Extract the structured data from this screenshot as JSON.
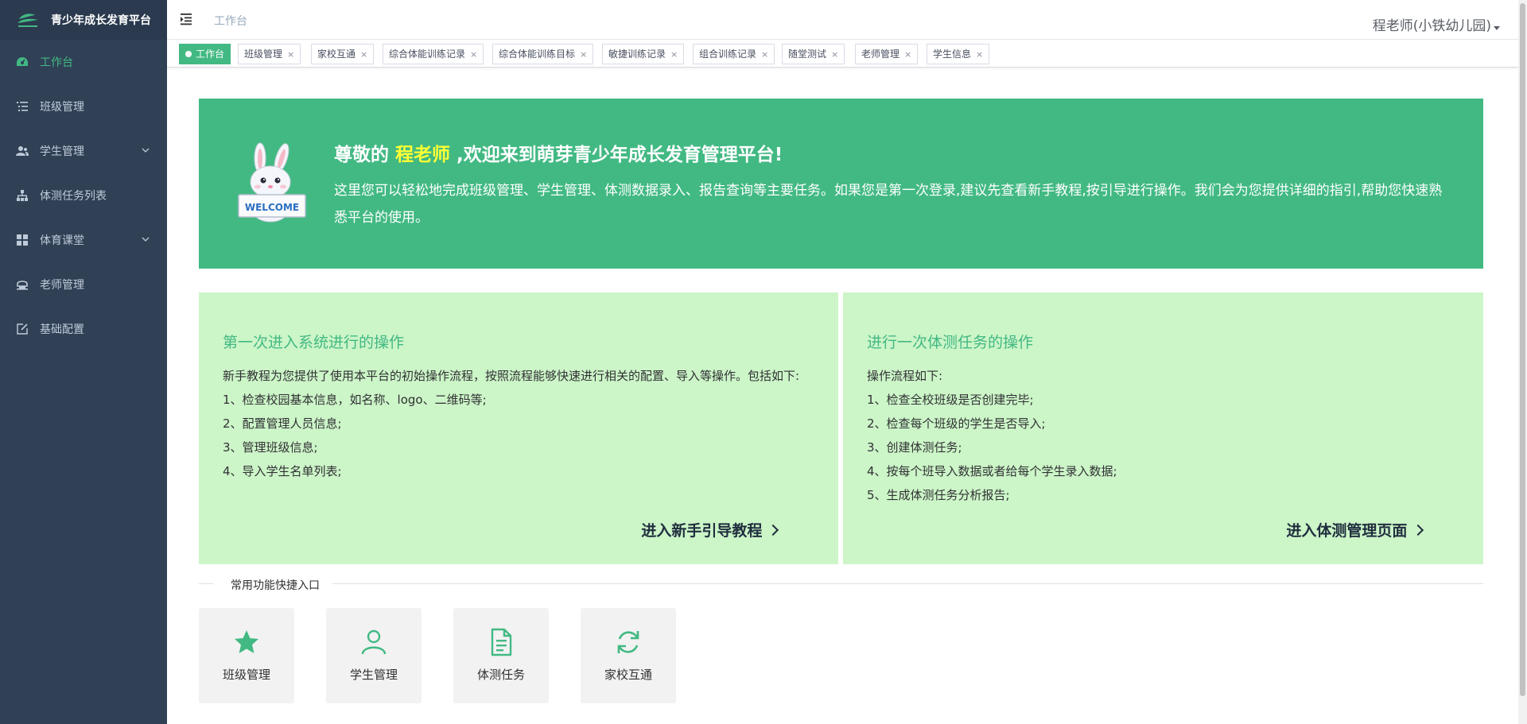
{
  "app": {
    "title": "青少年成长发育平台"
  },
  "sidebar": {
    "items": [
      {
        "label": "工作台",
        "icon": "dashboard-icon",
        "active": true
      },
      {
        "label": "班级管理",
        "icon": "list-icon"
      },
      {
        "label": "学生管理",
        "icon": "peoples-icon",
        "has_children": true
      },
      {
        "label": "体测任务列表",
        "icon": "tree-icon"
      },
      {
        "label": "体育课堂",
        "icon": "grid-icon",
        "has_children": true
      },
      {
        "label": "老师管理",
        "icon": "teacher-icon"
      },
      {
        "label": "基础配置",
        "icon": "edit-icon"
      }
    ]
  },
  "header": {
    "breadcrumb": "工作台",
    "user": "程老师(小铁幼儿园)"
  },
  "tags": [
    {
      "label": "工作台",
      "active": true
    },
    {
      "label": "班级管理",
      "close": "×"
    },
    {
      "label": "家校互通",
      "close": "×"
    },
    {
      "label": "综合体能训练记录",
      "close": "×"
    },
    {
      "label": "综合体能训练目标",
      "close": "×"
    },
    {
      "label": "敏捷训练记录",
      "close": "×"
    },
    {
      "label": "组合训练记录",
      "close": "×"
    },
    {
      "label": "随堂测试",
      "close": "×"
    },
    {
      "label": "老师管理",
      "close": "×"
    },
    {
      "label": "学生信息",
      "close": "×"
    }
  ],
  "welcome": {
    "image_text": "WELCOME",
    "greeting_prefix": "尊敬的",
    "name": "程老师",
    "greeting_suffix": ",欢迎来到萌芽青少年成长发育管理平台!",
    "description": "这里您可以轻松地完成班级管理、学生管理、体测数据录入、报告查询等主要任务。如果您是第一次登录,建议先查看新手教程,按引导进行操作。我们会为您提供详细的指引,帮助您快速熟悉平台的使用。"
  },
  "cards": {
    "left": {
      "title": "第一次进入系统进行的操作",
      "lines": [
        "新手教程为您提供了使用本平台的初始操作流程，按照流程能够快速进行相关的配置、导入等操作。包括如下:",
        "1、检查校园基本信息，如名称、logo、二维码等;",
        "2、配置管理人员信息;",
        "3、管理班级信息;",
        "4、导入学生名单列表;"
      ],
      "link": "进入新手引导教程"
    },
    "right": {
      "title": "进行一次体测任务的操作",
      "lines": [
        "操作流程如下:",
        "1、检查全校班级是否创建完毕;",
        "2、检查每个班级的学生是否导入;",
        "3、创建体测任务;",
        "4、按每个班导入数据或者给每个学生录入数据;",
        "5、生成体测任务分析报告;"
      ],
      "link": "进入体测管理页面"
    }
  },
  "quick_access": {
    "title": "常用功能快捷入口",
    "items": [
      {
        "label": "班级管理",
        "icon": "star-icon"
      },
      {
        "label": "学生管理",
        "icon": "user-icon"
      },
      {
        "label": "体测任务",
        "icon": "document-icon"
      },
      {
        "label": "家校互通",
        "icon": "refresh-icon"
      }
    ]
  },
  "colors": {
    "sidebar_bg": "#304156",
    "accent": "#42b983",
    "card_bg": "#ccf5c8",
    "highlight": "#ffff33"
  }
}
